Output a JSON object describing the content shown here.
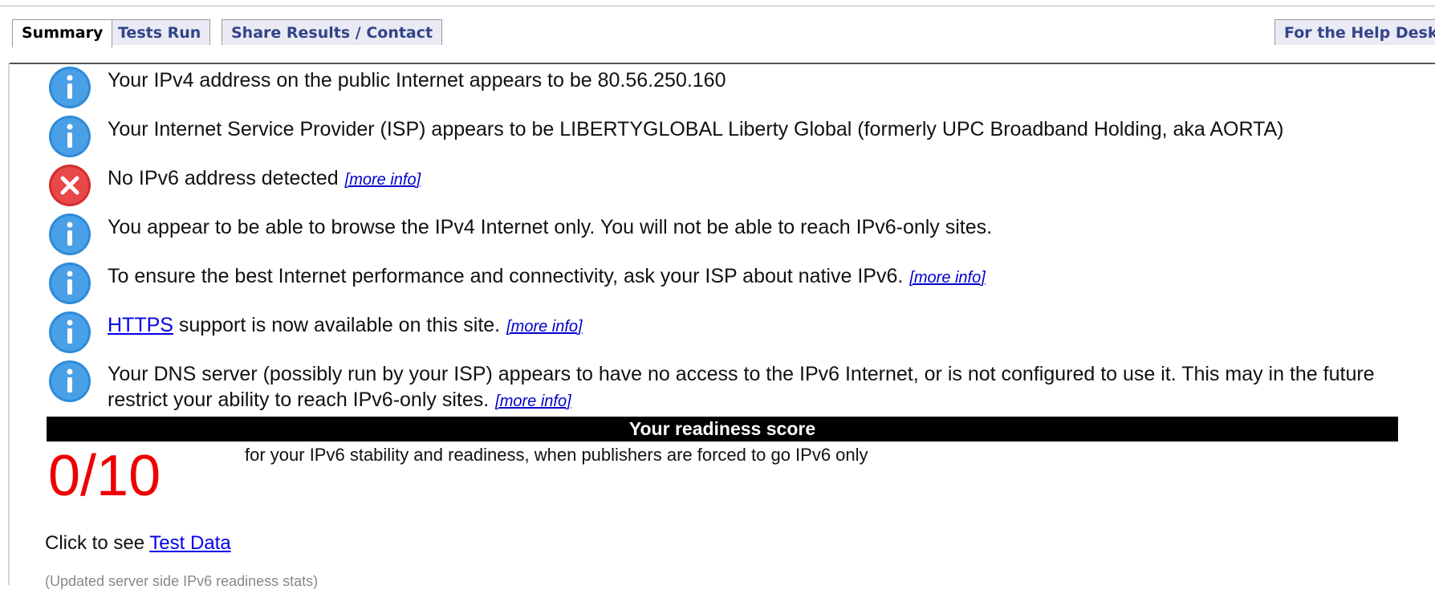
{
  "tabs": [
    {
      "label": "Summary",
      "active": true
    },
    {
      "label": "Tests Run",
      "active": false
    },
    {
      "label": "Share Results / Contact",
      "active": false
    },
    {
      "label": "For the Help Desk",
      "active": false
    }
  ],
  "messages": [
    {
      "icon": "info-icon",
      "text": "Your IPv4 address on the public Internet appears to be 80.56.250.160"
    },
    {
      "icon": "info-icon",
      "text": "Your Internet Service Provider (ISP) appears to be LIBERTYGLOBAL Liberty Global (formerly UPC Broadband Holding, aka AORTA)"
    },
    {
      "icon": "error-icon",
      "text": "No IPv6 address detected",
      "more": "[more info]"
    },
    {
      "icon": "info-icon",
      "text": "You appear to be able to browse the IPv4 Internet only. You will not be able to reach IPv6-only sites."
    },
    {
      "icon": "info-icon",
      "text": "To ensure the best Internet performance and connectivity, ask your ISP about native IPv6.",
      "more": "[more info]"
    },
    {
      "icon": "info-icon",
      "link": "HTTPS",
      "text": " support is now available on this site.",
      "more": "[more info]"
    },
    {
      "icon": "info-icon",
      "text": "Your DNS server (possibly run by your ISP) appears to have no access to the IPv6 Internet, or is not configured to use it. This may in the future restrict your ability to reach IPv6-only sites.",
      "more": "[more info]"
    }
  ],
  "readiness": {
    "heading": "Your readiness score",
    "score": "0/10",
    "description": "for your IPv6 stability and readiness, when publishers are forced to go IPv6 only"
  },
  "test_data": {
    "prefix": "Click to see ",
    "link": "Test Data"
  },
  "updated_note": "(Updated server side IPv6 readiness stats)",
  "colors": {
    "info": "#2e8bd8",
    "error": "#e53b3b",
    "score": "#ee0000"
  }
}
